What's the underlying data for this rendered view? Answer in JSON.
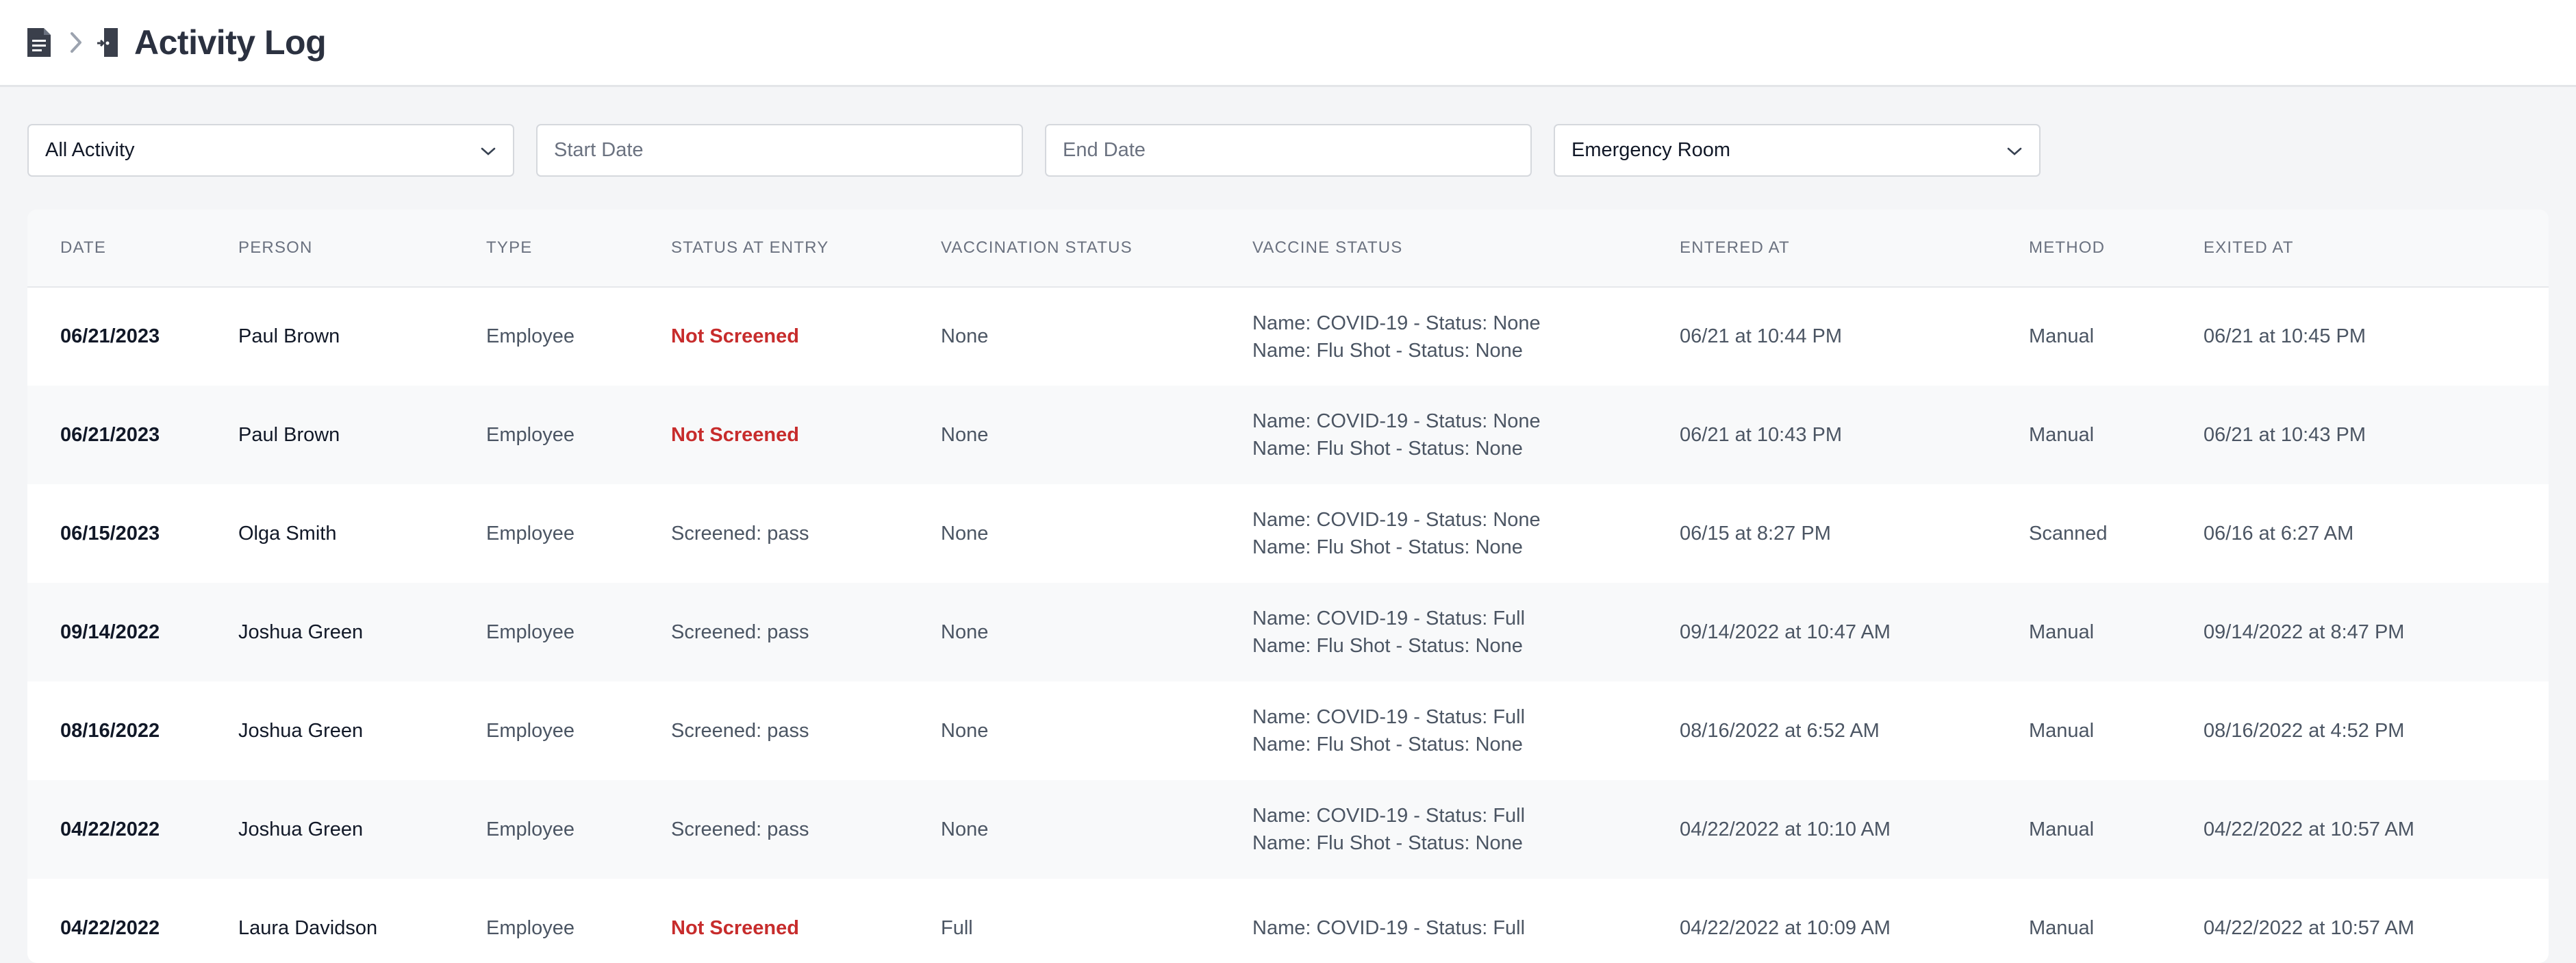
{
  "header": {
    "title": "Activity Log",
    "breadcrumb_root_icon": "document-icon",
    "breadcrumb_sep_icon": "chevron-right-icon",
    "breadcrumb_page_icon": "door-exit-icon"
  },
  "filters": {
    "activity_select": "All Activity",
    "start_date_placeholder": "Start Date",
    "end_date_placeholder": "End Date",
    "location_select": "Emergency Room"
  },
  "table": {
    "columns": [
      "DATE",
      "PERSON",
      "TYPE",
      "STATUS AT ENTRY",
      "VACCINATION STATUS",
      "VACCINE STATUS",
      "ENTERED AT",
      "METHOD",
      "EXITED AT"
    ],
    "rows": [
      {
        "date": "06/21/2023",
        "person": "Paul Brown",
        "type": "Employee",
        "status_entry": "Not Screened",
        "vaccination": "None",
        "vaccine_line1": "Name: COVID-19 - Status: None",
        "vaccine_line2": "Name: Flu Shot - Status: None",
        "entered": "06/21 at 10:44 PM",
        "method": "Manual",
        "exited": "06/21 at 10:45 PM"
      },
      {
        "date": "06/21/2023",
        "person": "Paul Brown",
        "type": "Employee",
        "status_entry": "Not Screened",
        "vaccination": "None",
        "vaccine_line1": "Name: COVID-19 - Status: None",
        "vaccine_line2": "Name: Flu Shot - Status: None",
        "entered": "06/21 at 10:43 PM",
        "method": "Manual",
        "exited": "06/21 at 10:43 PM"
      },
      {
        "date": "06/15/2023",
        "person": "Olga Smith",
        "type": "Employee",
        "status_entry": "Screened: pass",
        "vaccination": "None",
        "vaccine_line1": "Name: COVID-19 - Status: None",
        "vaccine_line2": "Name: Flu Shot - Status: None",
        "entered": "06/15 at 8:27 PM",
        "method": "Scanned",
        "exited": "06/16 at 6:27 AM"
      },
      {
        "date": "09/14/2022",
        "person": "Joshua Green",
        "type": "Employee",
        "status_entry": "Screened: pass",
        "vaccination": "None",
        "vaccine_line1": "Name: COVID-19 - Status: Full",
        "vaccine_line2": "Name: Flu Shot - Status: None",
        "entered": "09/14/2022 at 10:47 AM",
        "method": "Manual",
        "exited": "09/14/2022 at 8:47 PM"
      },
      {
        "date": "08/16/2022",
        "person": "Joshua Green",
        "type": "Employee",
        "status_entry": "Screened: pass",
        "vaccination": "None",
        "vaccine_line1": "Name: COVID-19 - Status: Full",
        "vaccine_line2": "Name: Flu Shot - Status: None",
        "entered": "08/16/2022 at 6:52 AM",
        "method": "Manual",
        "exited": "08/16/2022 at 4:52 PM"
      },
      {
        "date": "04/22/2022",
        "person": "Joshua Green",
        "type": "Employee",
        "status_entry": "Screened: pass",
        "vaccination": "None",
        "vaccine_line1": "Name: COVID-19 - Status: Full",
        "vaccine_line2": "Name: Flu Shot - Status: None",
        "entered": "04/22/2022 at 10:10 AM",
        "method": "Manual",
        "exited": "04/22/2022 at 10:57 AM"
      },
      {
        "date": "04/22/2022",
        "person": "Laura Davidson",
        "type": "Employee",
        "status_entry": "Not Screened",
        "vaccination": "Full",
        "vaccine_line1": "Name: COVID-19 - Status: Full",
        "vaccine_line2": "",
        "entered": "04/22/2022 at 10:09 AM",
        "method": "Manual",
        "exited": "04/22/2022 at 10:57 AM"
      }
    ]
  },
  "colors": {
    "not_screened": "#c72c2c",
    "header_bg": "#ffffff",
    "page_bg": "#f4f5f7"
  }
}
